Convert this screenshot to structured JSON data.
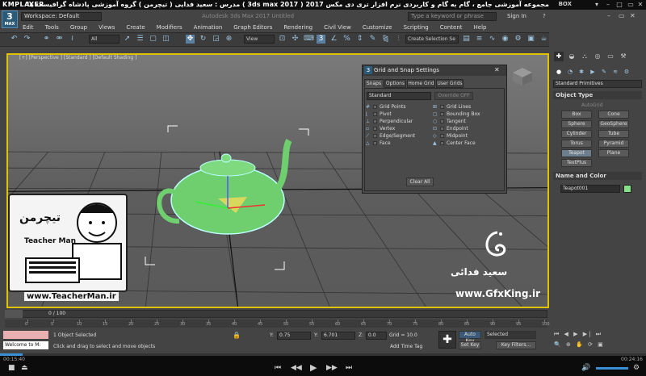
{
  "player": {
    "logo": "KMPLAYER",
    "title": "مجموعه آموزشی جامع ، گام به گام و کاربردی نرم افزار تری دی مکس 2017 ( 3ds max 2017 )  مدرس : سعید فدایی ( تیچرمن ) گروه آموزشی پادشاه گرافیست ها",
    "box_label": "BOX",
    "time_current": "00:15:40",
    "time_total": "00:24:16"
  },
  "app": {
    "logo_number": "3",
    "logo_text": "MAX",
    "workspace": "Workspace: Default",
    "title": "Autodesk 3ds Max 2017    Untitled",
    "search_placeholder": "Type a keyword or phrase",
    "signin": "Sign In",
    "menu": [
      "Edit",
      "Tools",
      "Group",
      "Views",
      "Create",
      "Modifiers",
      "Animation",
      "Graph Editors",
      "Rendering",
      "Civil View",
      "Customize",
      "Scripting",
      "Content",
      "Help"
    ]
  },
  "toolbar": {
    "selection_filter": "All",
    "ref_coord": "View",
    "named_selection": "Create Selection Se"
  },
  "viewport": {
    "label": "[+] [Perspective ] [Standard ] [Default Shading ]"
  },
  "dialog": {
    "title": "Grid and Snap Settings",
    "tabs": [
      "Snaps",
      "Options",
      "Home Grid",
      "User Grids"
    ],
    "dropdown": "Standard",
    "override": "Override OFF",
    "snaps_left": [
      "Grid Points",
      "Pivot",
      "Perpendicular",
      "Vertex",
      "Edge/Segment",
      "Face"
    ],
    "snaps_right": [
      "Grid Lines",
      "Bounding Box",
      "Tangent",
      "Endpoint",
      "Midpoint",
      "Center Face"
    ],
    "clear_all": "Clear All"
  },
  "command_panel": {
    "category": "Standard Primitives",
    "object_type_title": "Object Type",
    "autogrid": "AutoGrid",
    "primitives": [
      "Box",
      "Cone",
      "Sphere",
      "GeoSphere",
      "Cylinder",
      "Tube",
      "Torus",
      "Pyramid",
      "Teapot",
      "Plane",
      "TextPlus"
    ],
    "name_color_title": "Name and Color",
    "object_name": "Teapot001",
    "object_color": "#86e086"
  },
  "timeline": {
    "slider": "0 / 100",
    "ticks": [
      "0",
      "5",
      "10",
      "15",
      "20",
      "25",
      "30",
      "35",
      "40",
      "45",
      "50",
      "55",
      "60",
      "65",
      "70",
      "75",
      "80",
      "85",
      "90",
      "95",
      "100"
    ]
  },
  "status": {
    "listener": "Welcome to M:",
    "line1": "1 Object Selected",
    "line2": "Click and drag to select and move objects",
    "x_label": "X:",
    "x_value": "",
    "y_label": "Y:",
    "y_value": "0.75",
    "z_label": "Y:",
    "z_value": "6.701",
    "w_label": "Z:",
    "w_value": "0.0",
    "grid": "Grid = 10.0",
    "add_time_tag": "Add Time Tag",
    "auto_key": "Auto Key",
    "selected": "Selected",
    "set_key": "Set Key",
    "key_filters": "Key Filters..."
  },
  "branding": {
    "teacher_logo": "تیچرمن",
    "teacher_name": "Teacher Man",
    "teacher_url": "www.TeacherMan.ir",
    "signature": "سعید فدائی",
    "site": "www.GfxKing.ir"
  }
}
